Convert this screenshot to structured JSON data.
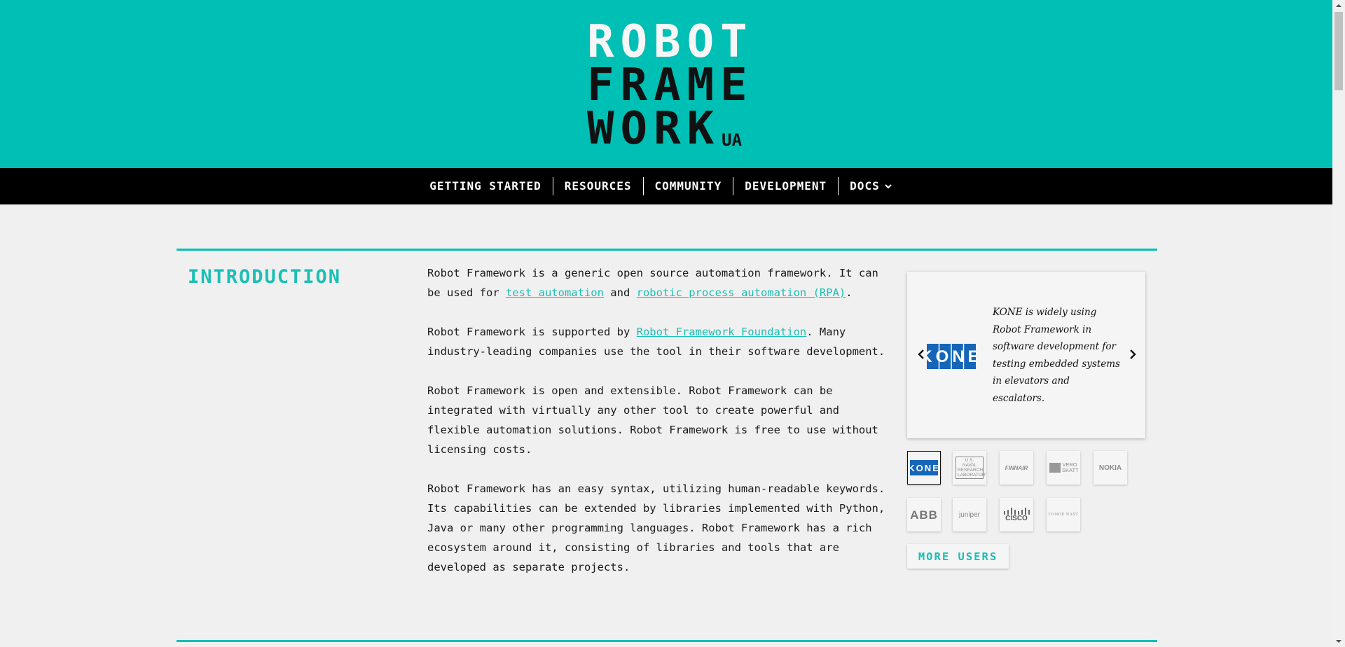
{
  "header": {
    "logo_lines": [
      "ROBOT",
      "FRAME",
      "WORK"
    ],
    "logo_suffix": "UA"
  },
  "nav": {
    "items": [
      "GETTING STARTED",
      "RESOURCES",
      "COMMUNITY",
      "DEVELOPMENT",
      "DOCS"
    ]
  },
  "intro": {
    "title": "INTRODUCTION",
    "p1_prefix": "Robot Framework is a generic open source automation framework. It can be used for ",
    "link_test_automation": "test automation",
    "p1_and": " and ",
    "link_rpa": "robotic process automation (RPA)",
    "p1_suffix": ".",
    "p2_prefix": "Robot Framework is supported by ",
    "link_foundation": "Robot Framework Foundation",
    "p2_suffix": ". Many industry-leading companies use the tool in their software development.",
    "p3": "Robot Framework is open and extensible. Robot Framework can be integrated with virtually any other tool to create powerful and flexible automation solutions. Robot Framework is free to use without licensing costs.",
    "p4": "Robot Framework has an easy syntax, utilizing human-readable keywords. Its capabilities can be extended by libraries implemented with Python, Java or many other programming languages. Robot Framework has a rich ecosystem around it, consisting of libraries and tools that are developed as separate projects."
  },
  "users": {
    "current_logo_text": "KONE",
    "quote": "KONE is widely using Robot Framework in software development for testing embedded systems in elevators and escalators.",
    "thumbs": [
      "KONE",
      "U.S. NAVAL RESEARCH LABORATORY",
      "FINNAIR",
      "VERO SKATT",
      "NOKIA",
      "ABB",
      "JUNIPER",
      "CISCO",
      "CONDE NAST"
    ],
    "more_users_label": "MORE USERS"
  },
  "colors": {
    "accent": "#00bfb5",
    "nav_bg": "#000000",
    "page_bg": "#f0f0f0",
    "kone_blue": "#1566b8"
  }
}
